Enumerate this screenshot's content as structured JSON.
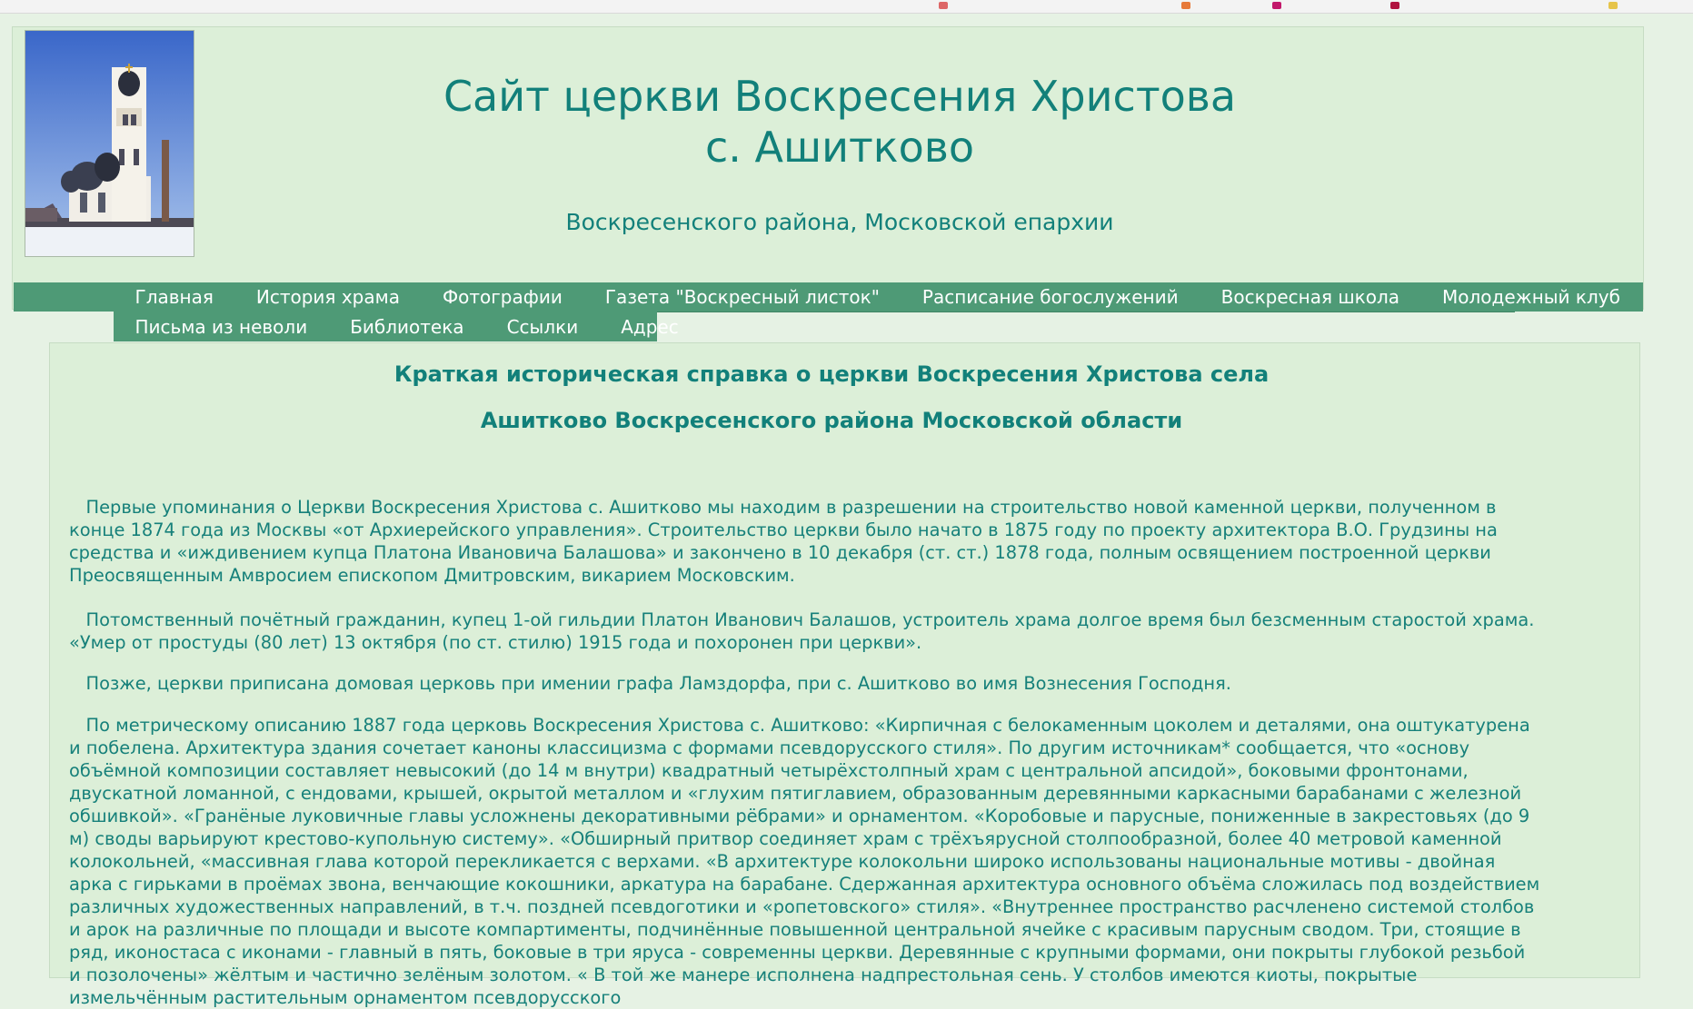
{
  "header": {
    "title_line1": "Сайт церкви Воскресения Христова",
    "title_line2": "с. Ашитково",
    "subtitle": "Воскресенского района, Московской епархии"
  },
  "nav": {
    "row1": [
      "Главная",
      "История храма",
      "Фотографии",
      "Газета \"Воскресный листок\"",
      "Расписание богослужений",
      "Воскресная школа",
      "Молодежный клуб"
    ],
    "row2": [
      "Письма из неволи",
      "Библиотека",
      "Ссылки",
      "Адрес"
    ]
  },
  "article": {
    "heading_line1": "Краткая историческая справка о церкви Воскресения Христова села",
    "heading_line2": "Ашитково Воскресенского района Московской области",
    "paragraphs": [
      "   Первые упоминания о Церкви Воскресения Христова с. Ашитково мы находим в разрешении на строительство новой каменной церкви, полученном в конце 1874 года из Москвы «от Архиерейского управления». Строительство церкви было начато в 1875 году по проекту архитектора В.О. Грудзины на средства и «иждивением купца Платона Ивановича Балашова» и закончено в 10 декабря (ст. ст.) 1878 года, полным освящением построенной церкви Преосвященным Амвросием епископом Дмитровским, викарием Московским.",
      "   Потомственный почётный гражданин, купец 1-ой гильдии Платон Иванович Балашов, устроитель храма долгое время был безсменным старостой храма. «Умер от простуды (80 лет) 13 октября (по ст. стилю) 1915 года и похоронен при церкви».",
      "   Позже, церкви приписана домовая церковь при имении графа Ламздорфа, при с. Ашитково во имя Вознесения Господня.",
      "   По метрическому описанию 1887 года церковь Воскресения Христова с. Ашитково: «Кирпичная с белокаменным цоколем и деталями, она оштукатурена и побелена. Архитектура здания сочетает каноны классицизма с формами псевдорусского стиля». По другим источникам* сообщается, что «основу объёмной композиции составляет невысокий (до 14 м внутри) квадратный четырёхстолпный храм с центральной апсидой», боковыми фронтонами, двускатной ломанной, с ендовами, крышей, окрытой металлом и «глухим пятиглавием, образованным деревянными каркасными барабанами с железной обшивкой». «Гранёные луковичные главы усложнены декоративными рёбрами» и орнаментом. «Коробовые и парусные, пониженные в закрестовьях (до 9 м) своды варьируют крестово-купольную систему». «Обширный притвор соединяет храм с трёхъярусной столпообразной, более 40 метровой каменной колокольней, «массивная глава которой перекликается с верхами. «В архитектуре колокольни широко использованы национальные мотивы - двойная арка с гирьками в проёмах звона, венчающие кокошники, аркатура на барабане. Сдержанная архитектура основного объёма сложилась под воздействием различных художественных направлений, в т.ч. поздней псевдоготики и «ропетовского» стиля». «Внутреннее пространство расчленено системой столбов и арок на различные по площади и высоте компартименты, подчинённые повышенной центральной ячейке с красивым парусным сводом. Три, стоящие в ряд, иконостаса с иконами - главный в пять, боковые в три яруса - современны церкви. Деревянные с крупными формами, они покрыты глубокой резьбой и позолочены» жёлтым и частично зелёным золотом. « В той же манере исполнена надпрестольная сень. У столбов имеются киоты, покрытые измельчённым растительным орнаментом псевдорусского"
    ]
  },
  "colors": {
    "accent": "#12807a",
    "nav_bg": "#4e9a76",
    "page_bg": "#e6f2e4",
    "panel_bg": "#dcefd8"
  }
}
